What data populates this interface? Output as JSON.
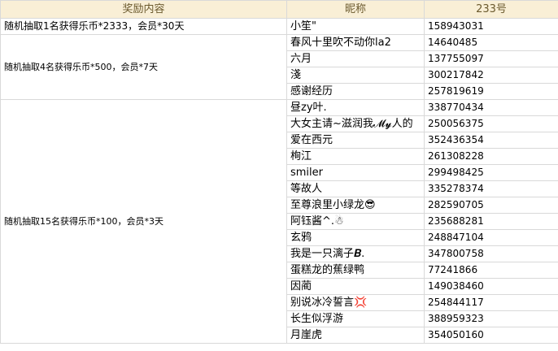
{
  "headers": {
    "prize": "奖励内容",
    "nickname": "昵称",
    "id": "233号"
  },
  "groups": [
    {
      "prize": "随机抽取1名获得乐币*2333，会员*30天",
      "winners": [
        {
          "nickname": "小笙\"",
          "id": "158943031"
        }
      ]
    },
    {
      "prize": "随机抽取4名获得乐币*500，会员*7天",
      "winners": [
        {
          "nickname": "春风十里吹不动你la2",
          "id": "14640485"
        },
        {
          "nickname": "六月",
          "id": "137755097"
        },
        {
          "nickname": "淺",
          "id": "300217842"
        },
        {
          "nickname": "感谢经历",
          "id": "257819619"
        }
      ]
    },
    {
      "prize": "随机抽取15名获得乐币*100，会员*3天",
      "winners": [
        {
          "nickname": "昼zy叶.",
          "id": "338770434"
        },
        {
          "nickname": "大女主请~滋润我𝓜𝔂人的",
          "id": "250056375"
        },
        {
          "nickname": "爱在西元",
          "id": "352436354"
        },
        {
          "nickname": "栒江",
          "id": "261308228"
        },
        {
          "nickname": "smiler",
          "id": "299498425"
        },
        {
          "nickname": "等故人",
          "id": "335278374"
        },
        {
          "nickname": "至尊浪里小绿龙😎",
          "id": "282590705"
        },
        {
          "nickname": "阿钰酱^.☃",
          "id": "235688281"
        },
        {
          "nickname": "玄鸦",
          "id": "248847104"
        },
        {
          "nickname": "我是一只漓子𝑩.",
          "id": "347800758"
        },
        {
          "nickname": "蛋糕龙的蕉绿鸭",
          "id": "77241866"
        },
        {
          "nickname": "因蔺",
          "id": "149038460"
        },
        {
          "nickname": "别说冰冷誓言💢",
          "id": "254844117"
        },
        {
          "nickname": "长生似浮游",
          "id": "388959323"
        },
        {
          "nickname": "月崖虎",
          "id": "354050160"
        }
      ]
    }
  ]
}
